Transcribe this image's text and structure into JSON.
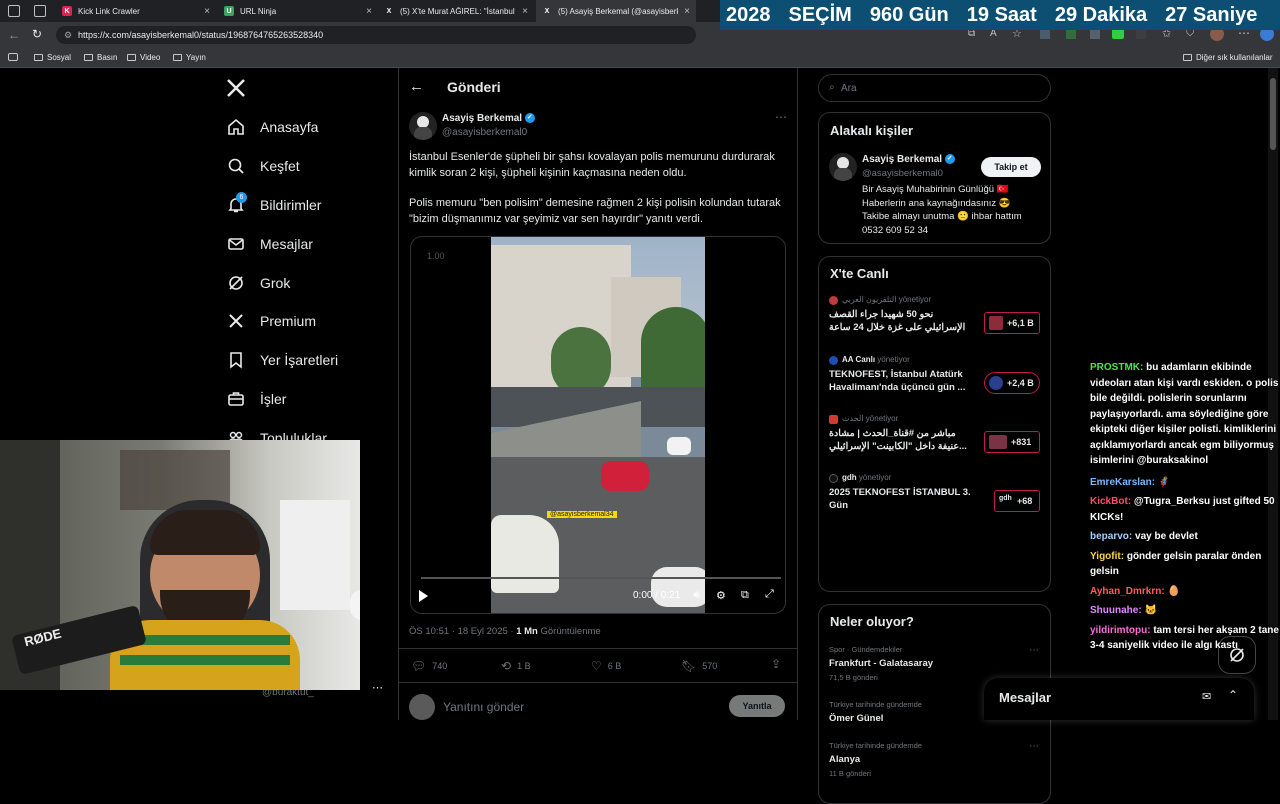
{
  "browser": {
    "tabs": [
      {
        "title": "Kick Link Crawler",
        "fav_color": "#e0244d",
        "fav_text": "K"
      },
      {
        "title": "URL Ninja",
        "fav_color": "#3aa55d",
        "fav_text": "U"
      },
      {
        "title": "(5) X'te Murat AĞIREL: \"İstanbul ...",
        "fav_color": "#ffffff",
        "fav_text": "X"
      },
      {
        "title": "(5) Asayiş Berkemal (@asayisberk...",
        "fav_color": "#ffffff",
        "fav_text": "X"
      }
    ],
    "url": "https://x.com/asayisberkemal0/status/1968764765263528340",
    "bookmarks": [
      "Sosyal",
      "Basın",
      "Video",
      "Yayın"
    ],
    "other_bookmarks": "Diğer sık kullanılanlar"
  },
  "countdown": {
    "year": "2028",
    "event": "SEÇİM",
    "days": "960 Gün",
    "hours": "19 Saat",
    "minutes": "29 Dakika",
    "seconds": "27 Saniye"
  },
  "nav": {
    "items": [
      {
        "label": "Anasayfa",
        "icon": "home-icon"
      },
      {
        "label": "Keşfet",
        "icon": "search-icon"
      },
      {
        "label": "Bildirimler",
        "icon": "bell-icon",
        "badge": "6"
      },
      {
        "label": "Mesajlar",
        "icon": "mail-icon"
      },
      {
        "label": "Grok",
        "icon": "grok-icon"
      },
      {
        "label": "Premium",
        "icon": "x-icon"
      },
      {
        "label": "Yer İşaretleri",
        "icon": "bookmark-icon"
      },
      {
        "label": "İşler",
        "icon": "briefcase-icon"
      },
      {
        "label": "Topluluklar",
        "icon": "community-icon"
      }
    ],
    "profile_handle": "@buraktut_"
  },
  "post": {
    "header": "Gönderi",
    "author_name": "Asayiş Berkemal",
    "author_handle": "@asayisberkemal0",
    "text1": "İstanbul Esenler'de şüpheli bir şahsı kovalayan polis memurunu durdurarak kimlik soran 2 kişi, şüpheli kişinin kaçmasına neden oldu.",
    "text2": "Polis memuru \"ben polisim\" demesine rağmen 2 kişi polisin kolundan tutarak \"bizim düşmanımız var şeyimiz var sen hayırdır\" yanıtı verdi.",
    "video": {
      "speed": "1.00",
      "watermark": "@asayisberkemal34",
      "time": "0:00 / 0:21",
      "progress": 0.0
    },
    "timestamp": "ÖS 10:51 · 18 Eyl 2025 · ",
    "views": "1 Mn",
    "views_label": "Görüntülenme",
    "stats": {
      "replies": "740",
      "reposts": "1 B",
      "likes": "6 B",
      "bookmarks": "570"
    },
    "reply_placeholder": "Yanıtını gönder",
    "reply_button": "Yanıtla"
  },
  "sidebar": {
    "search_placeholder": "Ara",
    "related": {
      "title": "Alakalı kişiler",
      "name": "Asayiş Berkemal",
      "handle": "@asayisberkemal0",
      "follow_label": "Takip et",
      "bio_lines": [
        "Bir Asayiş Muhabirinin Günlüğü 🇹🇷",
        "Haberlerin ana kaynağındasınız 😎",
        "Takibe almayı unutma 🙂 ihbar hattım",
        "0532 609 52 34"
      ]
    },
    "live": {
      "title": "X'te Canlı",
      "items": [
        {
          "host": "التلفزيون العربي",
          "role": "yönetiyor",
          "title1": "نحو 50 شهيدا جراء القصف",
          "title2": "الإسرائيلي على غزة خلال 24 ساعة",
          "count": "+6,1 B"
        },
        {
          "host": "AA Canlı",
          "role": "yönetiyor",
          "title1": "TEKNOFEST, İstanbul Atatürk",
          "title2": "Havalimanı'nda üçüncü gün ...",
          "count": "+2,4 B"
        },
        {
          "host": "الحدث",
          "role": "yönetiyor",
          "title1": "مباشر من #قناة_الحدث | مشادة",
          "title2": "عنيفة داخل \"الكابينت\" الإسرائيلي...",
          "count": "+831"
        },
        {
          "host": "gdh",
          "role": "yönetiyor",
          "title1": "2025 TEKNOFEST İSTANBUL 3.",
          "title2": "Gün",
          "count": "+68"
        }
      ]
    },
    "trends": {
      "title": "Neler oluyor?",
      "items": [
        {
          "context": "Spor · Gündemdekiler",
          "name": "Frankfurt - Galatasaray",
          "count": "71,5 B gönderi"
        },
        {
          "context": "Türkiye tarihinde gündemde",
          "name": "Ömer Günel",
          "count": ""
        },
        {
          "context": "Türkiye tarihinde gündemde",
          "name": "Alanya",
          "count": "11 B gönderi"
        }
      ]
    },
    "messages_label": "Mesajlar"
  },
  "chat": [
    {
      "user": "PROSTMK:",
      "user_color": "#52e052",
      "text": "bu adamların ekibinde videoları atan kişi vardı eskiden. o polis bile değildi. polislerin sorunlarını paylaşıyorlardı. ama söylediğine göre ekipteki diğer kişiler polisti. kimliklerini açıklamıyorlardı ancak egm biliyormuş isimlerini @buraksakinol"
    },
    {
      "user": "EmreKarslan:",
      "user_color": "#7ab9ff",
      "text": "🦸"
    },
    {
      "user": "KickBot:",
      "user_color": "#ff4d6d",
      "text": "@Tugra_Berksu just gifted 50 KICKs!"
    },
    {
      "user": "beparvo:",
      "user_color": "#9fd0ff",
      "text": "vay be devlet"
    },
    {
      "user": "Yigofit:",
      "user_color": "#ffd24d",
      "text": "gönder gelsin paralar önden gelsin"
    },
    {
      "user": "Ayhan_Dmrkrn:",
      "user_color": "#ff5c5c",
      "text": "🥚"
    },
    {
      "user": "Shuunahe:",
      "user_color": "#e08cff",
      "text": "🐱"
    },
    {
      "user": "yildirimtopu:",
      "user_color": "#ff6bd8",
      "text": "tam tersi her akşam 2 tane 3-4 saniyelik video ile algı kastı"
    }
  ],
  "overlay": {
    "rode_label": "RØDE"
  },
  "colors": {
    "accent": "#1d9bf0",
    "counter_bg": "#0d4f73"
  }
}
